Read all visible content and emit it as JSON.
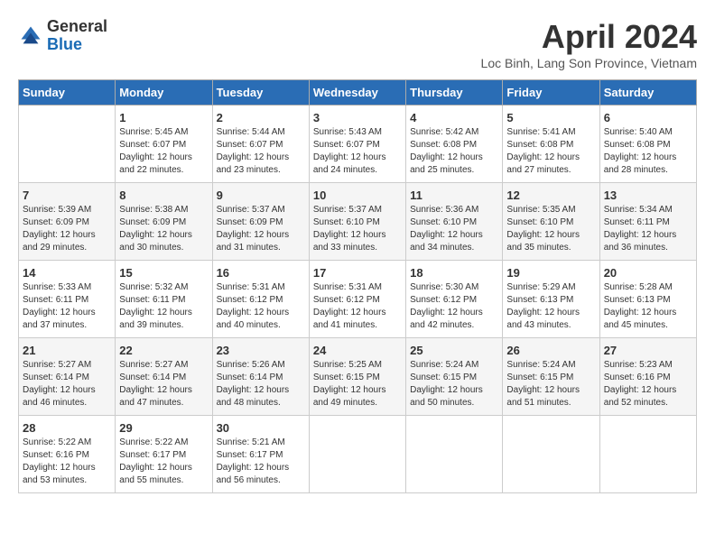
{
  "header": {
    "logo_general": "General",
    "logo_blue": "Blue",
    "title": "April 2024",
    "location": "Loc Binh, Lang Son Province, Vietnam"
  },
  "weekdays": [
    "Sunday",
    "Monday",
    "Tuesday",
    "Wednesday",
    "Thursday",
    "Friday",
    "Saturday"
  ],
  "weeks": [
    [
      {
        "day": "",
        "sunrise": "",
        "sunset": "",
        "daylight": ""
      },
      {
        "day": "1",
        "sunrise": "Sunrise: 5:45 AM",
        "sunset": "Sunset: 6:07 PM",
        "daylight": "Daylight: 12 hours and 22 minutes."
      },
      {
        "day": "2",
        "sunrise": "Sunrise: 5:44 AM",
        "sunset": "Sunset: 6:07 PM",
        "daylight": "Daylight: 12 hours and 23 minutes."
      },
      {
        "day": "3",
        "sunrise": "Sunrise: 5:43 AM",
        "sunset": "Sunset: 6:07 PM",
        "daylight": "Daylight: 12 hours and 24 minutes."
      },
      {
        "day": "4",
        "sunrise": "Sunrise: 5:42 AM",
        "sunset": "Sunset: 6:08 PM",
        "daylight": "Daylight: 12 hours and 25 minutes."
      },
      {
        "day": "5",
        "sunrise": "Sunrise: 5:41 AM",
        "sunset": "Sunset: 6:08 PM",
        "daylight": "Daylight: 12 hours and 27 minutes."
      },
      {
        "day": "6",
        "sunrise": "Sunrise: 5:40 AM",
        "sunset": "Sunset: 6:08 PM",
        "daylight": "Daylight: 12 hours and 28 minutes."
      }
    ],
    [
      {
        "day": "7",
        "sunrise": "Sunrise: 5:39 AM",
        "sunset": "Sunset: 6:09 PM",
        "daylight": "Daylight: 12 hours and 29 minutes."
      },
      {
        "day": "8",
        "sunrise": "Sunrise: 5:38 AM",
        "sunset": "Sunset: 6:09 PM",
        "daylight": "Daylight: 12 hours and 30 minutes."
      },
      {
        "day": "9",
        "sunrise": "Sunrise: 5:37 AM",
        "sunset": "Sunset: 6:09 PM",
        "daylight": "Daylight: 12 hours and 31 minutes."
      },
      {
        "day": "10",
        "sunrise": "Sunrise: 5:37 AM",
        "sunset": "Sunset: 6:10 PM",
        "daylight": "Daylight: 12 hours and 33 minutes."
      },
      {
        "day": "11",
        "sunrise": "Sunrise: 5:36 AM",
        "sunset": "Sunset: 6:10 PM",
        "daylight": "Daylight: 12 hours and 34 minutes."
      },
      {
        "day": "12",
        "sunrise": "Sunrise: 5:35 AM",
        "sunset": "Sunset: 6:10 PM",
        "daylight": "Daylight: 12 hours and 35 minutes."
      },
      {
        "day": "13",
        "sunrise": "Sunrise: 5:34 AM",
        "sunset": "Sunset: 6:11 PM",
        "daylight": "Daylight: 12 hours and 36 minutes."
      }
    ],
    [
      {
        "day": "14",
        "sunrise": "Sunrise: 5:33 AM",
        "sunset": "Sunset: 6:11 PM",
        "daylight": "Daylight: 12 hours and 37 minutes."
      },
      {
        "day": "15",
        "sunrise": "Sunrise: 5:32 AM",
        "sunset": "Sunset: 6:11 PM",
        "daylight": "Daylight: 12 hours and 39 minutes."
      },
      {
        "day": "16",
        "sunrise": "Sunrise: 5:31 AM",
        "sunset": "Sunset: 6:12 PM",
        "daylight": "Daylight: 12 hours and 40 minutes."
      },
      {
        "day": "17",
        "sunrise": "Sunrise: 5:31 AM",
        "sunset": "Sunset: 6:12 PM",
        "daylight": "Daylight: 12 hours and 41 minutes."
      },
      {
        "day": "18",
        "sunrise": "Sunrise: 5:30 AM",
        "sunset": "Sunset: 6:12 PM",
        "daylight": "Daylight: 12 hours and 42 minutes."
      },
      {
        "day": "19",
        "sunrise": "Sunrise: 5:29 AM",
        "sunset": "Sunset: 6:13 PM",
        "daylight": "Daylight: 12 hours and 43 minutes."
      },
      {
        "day": "20",
        "sunrise": "Sunrise: 5:28 AM",
        "sunset": "Sunset: 6:13 PM",
        "daylight": "Daylight: 12 hours and 45 minutes."
      }
    ],
    [
      {
        "day": "21",
        "sunrise": "Sunrise: 5:27 AM",
        "sunset": "Sunset: 6:14 PM",
        "daylight": "Daylight: 12 hours and 46 minutes."
      },
      {
        "day": "22",
        "sunrise": "Sunrise: 5:27 AM",
        "sunset": "Sunset: 6:14 PM",
        "daylight": "Daylight: 12 hours and 47 minutes."
      },
      {
        "day": "23",
        "sunrise": "Sunrise: 5:26 AM",
        "sunset": "Sunset: 6:14 PM",
        "daylight": "Daylight: 12 hours and 48 minutes."
      },
      {
        "day": "24",
        "sunrise": "Sunrise: 5:25 AM",
        "sunset": "Sunset: 6:15 PM",
        "daylight": "Daylight: 12 hours and 49 minutes."
      },
      {
        "day": "25",
        "sunrise": "Sunrise: 5:24 AM",
        "sunset": "Sunset: 6:15 PM",
        "daylight": "Daylight: 12 hours and 50 minutes."
      },
      {
        "day": "26",
        "sunrise": "Sunrise: 5:24 AM",
        "sunset": "Sunset: 6:15 PM",
        "daylight": "Daylight: 12 hours and 51 minutes."
      },
      {
        "day": "27",
        "sunrise": "Sunrise: 5:23 AM",
        "sunset": "Sunset: 6:16 PM",
        "daylight": "Daylight: 12 hours and 52 minutes."
      }
    ],
    [
      {
        "day": "28",
        "sunrise": "Sunrise: 5:22 AM",
        "sunset": "Sunset: 6:16 PM",
        "daylight": "Daylight: 12 hours and 53 minutes."
      },
      {
        "day": "29",
        "sunrise": "Sunrise: 5:22 AM",
        "sunset": "Sunset: 6:17 PM",
        "daylight": "Daylight: 12 hours and 55 minutes."
      },
      {
        "day": "30",
        "sunrise": "Sunrise: 5:21 AM",
        "sunset": "Sunset: 6:17 PM",
        "daylight": "Daylight: 12 hours and 56 minutes."
      },
      {
        "day": "",
        "sunrise": "",
        "sunset": "",
        "daylight": ""
      },
      {
        "day": "",
        "sunrise": "",
        "sunset": "",
        "daylight": ""
      },
      {
        "day": "",
        "sunrise": "",
        "sunset": "",
        "daylight": ""
      },
      {
        "day": "",
        "sunrise": "",
        "sunset": "",
        "daylight": ""
      }
    ]
  ]
}
